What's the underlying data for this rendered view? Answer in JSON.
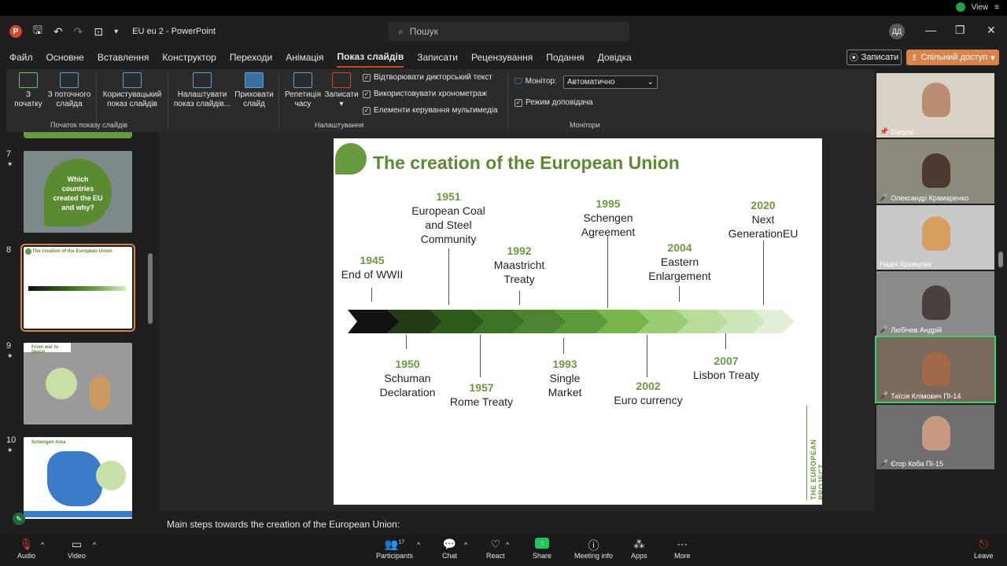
{
  "topstrip": {
    "view_label": "View"
  },
  "titlebar": {
    "doc_title": "EU eu 2  -  PowerPoint",
    "search_placeholder": "Пошук",
    "user_initials": "ДД"
  },
  "menu": {
    "tabs": [
      "Файл",
      "Основне",
      "Вставлення",
      "Конструктор",
      "Переходи",
      "Анімація",
      "Показ слайдів",
      "Записати",
      "Рецензування",
      "Подання",
      "Довідка"
    ],
    "active_tab": "Показ слайдів",
    "record": "Записати",
    "share": "Спільний доступ"
  },
  "ribbon": {
    "from_start": "З\nпочатку",
    "from_current": "З поточного\nслайда",
    "custom_show": "Користувацький\nпоказ слайдів",
    "group_start": "Початок показу слайдів",
    "setup": "Налаштувати\nпоказ слайдів...",
    "hide": "Приховати\nслайд",
    "rehearse": "Репетиція\nчасу",
    "record": "Записати",
    "chk_narration": "Відтворювати дикторський текст",
    "chk_timings": "Використовувати хронометраж",
    "chk_media": "Елементи керування мультимедіа",
    "group_setup": "Налаштування",
    "monitor_label": "Монітор:",
    "monitor_value": "Автоматично",
    "presenter_view": "Режим доповідача",
    "group_monitors": "Монітори"
  },
  "thumbnails": [
    {
      "num": "7",
      "title": "Which countries created the EU and why?"
    },
    {
      "num": "8",
      "title": "The creation of the European Union"
    },
    {
      "num": "9",
      "title": "From war to peace"
    },
    {
      "num": "10",
      "title": "Schengen Area"
    }
  ],
  "slide": {
    "title": "The creation of the European Union",
    "side_label": "THE EUROPEAN PROJECT",
    "top_events": [
      {
        "year": "1945",
        "text": "End of WWII"
      },
      {
        "year": "1951",
        "text": "European Coal and Steel Community"
      },
      {
        "year": "1992",
        "text": "Maastricht Treaty"
      },
      {
        "year": "1995",
        "text": "Schengen Agreement"
      },
      {
        "year": "2004",
        "text": "Eastern Enlargement"
      },
      {
        "year": "2020",
        "text": "Next GenerationEU"
      }
    ],
    "bottom_events": [
      {
        "year": "1950",
        "text": "Schuman Declaration"
      },
      {
        "year": "1957",
        "text": "Rome Treaty"
      },
      {
        "year": "1993",
        "text": "Single Market"
      },
      {
        "year": "2002",
        "text": "Euro currency"
      },
      {
        "year": "2007",
        "text": "Lisbon Treaty"
      }
    ]
  },
  "notes": "Main steps towards the creation of the European Union:",
  "participants": [
    {
      "name": "Daryna"
    },
    {
      "name": "Олександр Крамаренко"
    },
    {
      "name": "Надія Кравцова"
    },
    {
      "name": "Любічев Андрій"
    },
    {
      "name": "Таїсія Клімович ПІ-14"
    },
    {
      "name": "Єгор Коба ПІ-15"
    }
  ],
  "zoom_bar": {
    "audio": "Audio",
    "video": "Video",
    "participants": "Participants",
    "participants_count": "17",
    "chat": "Chat",
    "react": "React",
    "share": "Share",
    "meeting_info": "Meeting info",
    "apps": "Apps",
    "more": "More",
    "leave": "Leave"
  },
  "colors": {
    "accent": "#d24726",
    "slide_green": "#6a9a40",
    "zoom_share": "#23c45a"
  }
}
